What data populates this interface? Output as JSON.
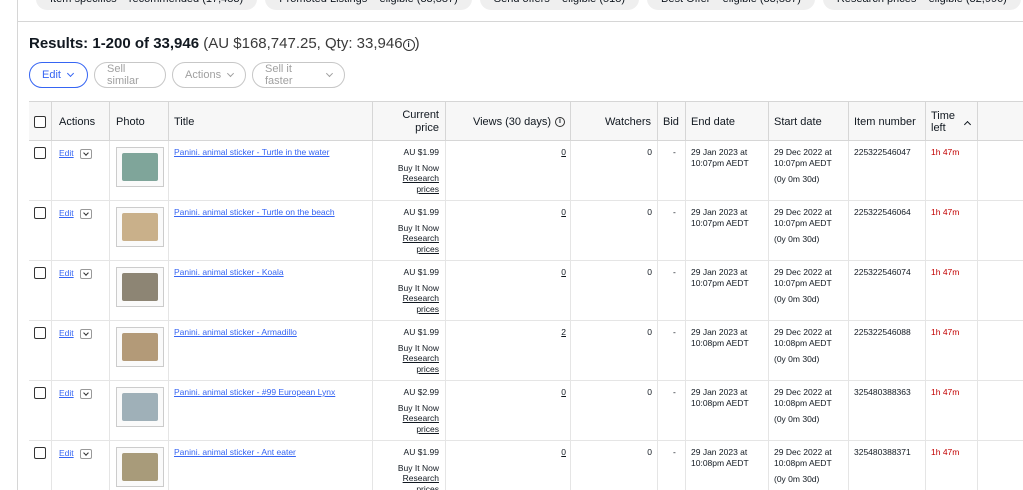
{
  "filter_chips": [
    "Item specifics – recommended (17,483)",
    "Promoted Listings – eligible (33,887)",
    "Send offers – eligible (518)",
    "Best Offer – eligible (33,887)",
    "Research prices – eligible (32,996)"
  ],
  "results": {
    "label": "Results: 1-200 of 33,946",
    "summary": "(AU $168,747.25, Qty: 33,946",
    "close": ")"
  },
  "toolbar": {
    "edit": "Edit",
    "sell_similar": "Sell similar",
    "actions": "Actions",
    "sell_faster": "Sell it faster"
  },
  "columns": {
    "actions": "Actions",
    "photo": "Photo",
    "title": "Title",
    "current_price_1": "Current",
    "current_price_2": "price",
    "views": "Views (30 days)",
    "watchers": "Watchers",
    "bid": "Bid",
    "end_date": "End date",
    "start_date": "Start date",
    "item_number": "Item number",
    "time_left_1": "Time",
    "time_left_2": "left"
  },
  "rows": [
    {
      "edit": "Edit",
      "title": "Panini. animal sticker - Turtle in the water",
      "price": "AU $1.99",
      "format": "Buy It Now",
      "research_1": "Research",
      "research_2": "prices",
      "views": "0",
      "watchers": "0",
      "bid": "-",
      "end_1": "29 Jan 2023 at",
      "end_2": "10:07pm AEDT",
      "start_1": "29 Dec 2022 at",
      "start_2": "10:07pm AEDT",
      "duration": "(0y 0m 30d)",
      "item_number": "225322546047",
      "time_left": "1h 47m",
      "thumb_color": "#7fa59a"
    },
    {
      "edit": "Edit",
      "title": "Panini. animal sticker - Turtle on the beach",
      "price": "AU $1.99",
      "format": "Buy It Now",
      "research_1": "Research",
      "research_2": "prices",
      "views": "0",
      "watchers": "0",
      "bid": "-",
      "end_1": "29 Jan 2023 at",
      "end_2": "10:07pm AEDT",
      "start_1": "29 Dec 2022 at",
      "start_2": "10:07pm AEDT",
      "duration": "(0y 0m 30d)",
      "item_number": "225322546064",
      "time_left": "1h 47m",
      "thumb_color": "#c9b08a"
    },
    {
      "edit": "Edit",
      "title": "Panini. animal sticker - Koala",
      "price": "AU $1.99",
      "format": "Buy It Now",
      "research_1": "Research",
      "research_2": "prices",
      "views": "0",
      "watchers": "0",
      "bid": "-",
      "end_1": "29 Jan 2023 at",
      "end_2": "10:07pm AEDT",
      "start_1": "29 Dec 2022 at",
      "start_2": "10:07pm AEDT",
      "duration": "(0y 0m 30d)",
      "item_number": "225322546074",
      "time_left": "1h 47m",
      "thumb_color": "#8d8574"
    },
    {
      "edit": "Edit",
      "title": "Panini. animal sticker - Armadillo",
      "price": "AU $1.99",
      "format": "Buy It Now",
      "research_1": "Research",
      "research_2": "prices",
      "views": "2",
      "watchers": "0",
      "bid": "-",
      "end_1": "29 Jan 2023 at",
      "end_2": "10:08pm AEDT",
      "start_1": "29 Dec 2022 at",
      "start_2": "10:08pm AEDT",
      "duration": "(0y 0m 30d)",
      "item_number": "225322546088",
      "time_left": "1h 47m",
      "thumb_color": "#b39a78"
    },
    {
      "edit": "Edit",
      "title": "Panini. animal sticker - #99 European Lynx",
      "price": "AU $2.99",
      "format": "Buy It Now",
      "research_1": "Research",
      "research_2": "prices",
      "views": "0",
      "watchers": "0",
      "bid": "-",
      "end_1": "29 Jan 2023 at",
      "end_2": "10:08pm AEDT",
      "start_1": "29 Dec 2022 at",
      "start_2": "10:08pm AEDT",
      "duration": "(0y 0m 30d)",
      "item_number": "325480388363",
      "time_left": "1h 47m",
      "thumb_color": "#9fb0b8"
    },
    {
      "edit": "Edit",
      "title": "Panini. animal sticker - Ant eater",
      "price": "AU $1.99",
      "format": "Buy It Now",
      "research_1": "Research",
      "research_2": "prices",
      "views": "0",
      "watchers": "0",
      "bid": "-",
      "end_1": "29 Jan 2023 at",
      "end_2": "10:08pm AEDT",
      "start_1": "29 Dec 2022 at",
      "start_2": "10:08pm AEDT",
      "duration": "(0y 0m 30d)",
      "item_number": "325480388371",
      "time_left": "1h 47m",
      "thumb_color": "#a89b7a"
    }
  ],
  "icons": {
    "views_info": "info-icon",
    "results_info": "info-icon",
    "sort": "chevron-up-icon",
    "dropdown": "chevron-down-icon"
  },
  "colors": {
    "link": "#3665f3",
    "time_left": "#c20000"
  }
}
